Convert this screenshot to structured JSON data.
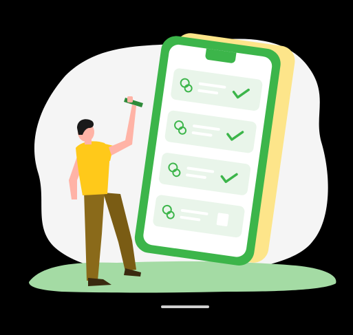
{
  "illustration": {
    "subject": "medication-checklist",
    "palette": {
      "background": "#000000",
      "blob": "#f5f5f5",
      "phone_frame": "#3cb54a",
      "phone_shadow": "#fde58a",
      "screen": "#ffffff",
      "card": "#e9f5ea",
      "check": "#3cb54a",
      "ground": "#a4dba4",
      "shirt": "#ffc91a",
      "pants": "#8a6a1a",
      "skin": "#ffb3a6",
      "hair": "#1a1a1a"
    },
    "checklist": [
      {
        "icon": "pill-icon",
        "checked": true
      },
      {
        "icon": "pill-icon",
        "checked": true
      },
      {
        "icon": "pill-icon",
        "checked": true
      },
      {
        "icon": "pill-icon",
        "checked": false
      }
    ]
  }
}
